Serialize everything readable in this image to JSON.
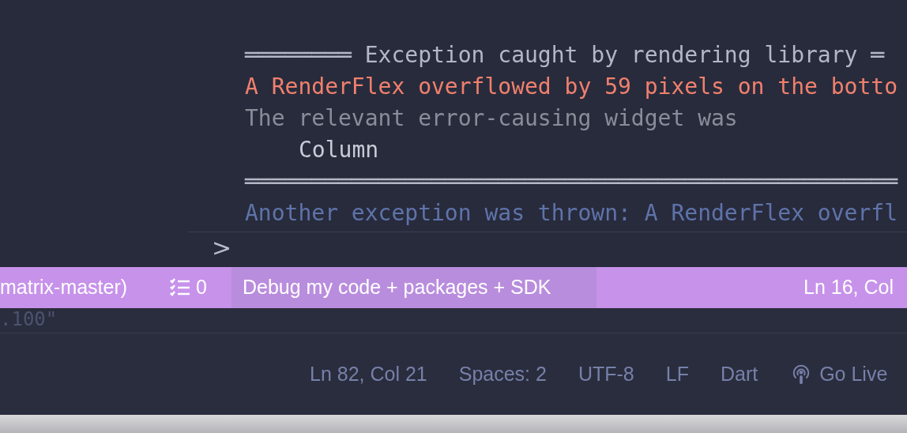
{
  "console": {
    "lines": [
      {
        "kind": "header",
        "text": "════════ Exception caught by rendering library ═"
      },
      {
        "kind": "error",
        "text": "A RenderFlex overflowed by 59 pixels on the botto"
      },
      {
        "kind": "info",
        "text": "The relevant error-causing widget was"
      },
      {
        "kind": "widget",
        "text": "Column"
      },
      {
        "kind": "rule",
        "text": "═════════════════════════════════════════════════"
      },
      {
        "kind": "repeat",
        "text": "Another exception was thrown: A RenderFlex overfl"
      }
    ],
    "prompt": ">"
  },
  "status_bar": {
    "branch": "matrix-master)",
    "problems": "0",
    "debug_mode": "Debug my code + packages + SDK",
    "position": "Ln 16, Col"
  },
  "back_window": {
    "code_line": ".100\"",
    "status_bar": {
      "items": [
        "Ln 82, Col 21",
        "Spaces: 2",
        "UTF-8",
        "LF",
        "Dart"
      ],
      "go_live": "Go Live"
    }
  }
}
